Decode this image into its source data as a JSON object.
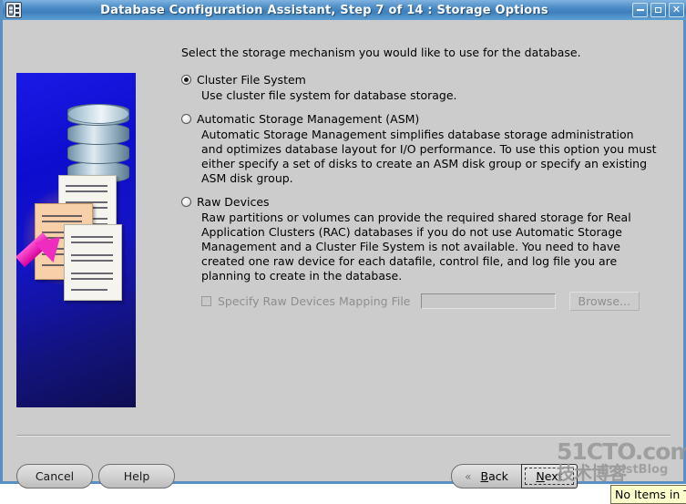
{
  "window": {
    "title": "Database Configuration Assistant, Step 7 of 14 : Storage Options",
    "icon": "database-server-icon",
    "controls": {
      "minimize": "_",
      "maximize": "□",
      "close": "✕"
    }
  },
  "main": {
    "intro": "Select the storage mechanism you would like to use for the database.",
    "options": [
      {
        "id": "cluster-file-system",
        "label": "Cluster File System",
        "selected": true,
        "description": "Use cluster file system for database storage."
      },
      {
        "id": "automatic-storage-management",
        "label": "Automatic Storage Management (ASM)",
        "selected": false,
        "description": "Automatic Storage Management simplifies database storage administration and optimizes database layout for I/O performance. To use this option you must either specify a set of disks to create an ASM disk group or specify an existing ASM disk group."
      },
      {
        "id": "raw-devices",
        "label": "Raw Devices",
        "selected": false,
        "description": "Raw partitions or volumes can provide the required shared storage for Real Application Clusters (RAC) databases if you do not use Automatic Storage Management and a Cluster File System is not available.  You need to have created one raw device for each datafile, control file, and log file you are planning to create in the database."
      }
    ],
    "raw_mapping": {
      "checkbox_label": "Specify Raw Devices Mapping File",
      "checked": false,
      "enabled": false,
      "field_value": "",
      "browse_label": "Browse..."
    }
  },
  "footer": {
    "cancel_label": "Cancel",
    "help_label": "Help",
    "back_label": "Back",
    "back_mnemonic": "B",
    "next_label": "Next",
    "next_mnemonic": "N",
    "back_chevron": "«"
  },
  "overlay": {
    "watermark_top": "51CTO.com",
    "watermark_mid": "技术博客",
    "watermark_sub": "nistBlog",
    "tooltip_text": "No Items in T"
  },
  "colors": {
    "titlebar_blue": "#3d7fbd",
    "panel_grey": "#cccccc",
    "image_blue": "#1414c4",
    "arrow_magenta": "#ef2cc0",
    "tooltip_yellow": "#ffffcc",
    "disabled_text": "#8e8e8e"
  }
}
